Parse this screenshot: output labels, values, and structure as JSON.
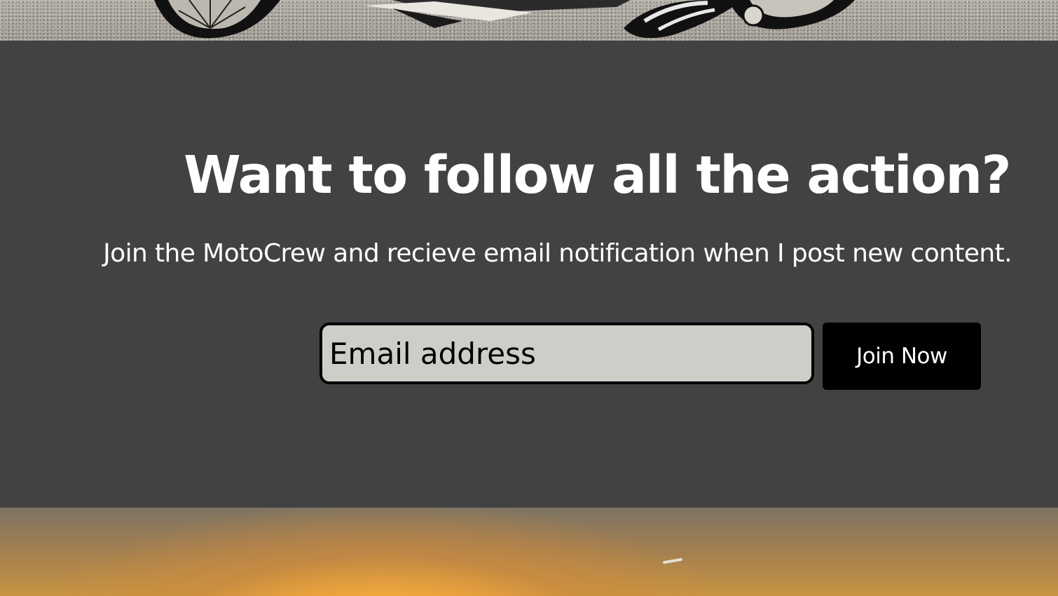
{
  "signup": {
    "title": "Want to follow all the action?",
    "subtitle": "Join the MotoCrew and recieve email notification when I post new content.",
    "email_placeholder": "Email address",
    "button_label": "Join Now"
  },
  "colors": {
    "section_background": "#424242",
    "input_background": "#cfcdc8",
    "button_background": "#000000",
    "text": "#ffffff"
  },
  "images": {
    "top": "motorcycle-photo",
    "bottom": "sunset-photo"
  }
}
